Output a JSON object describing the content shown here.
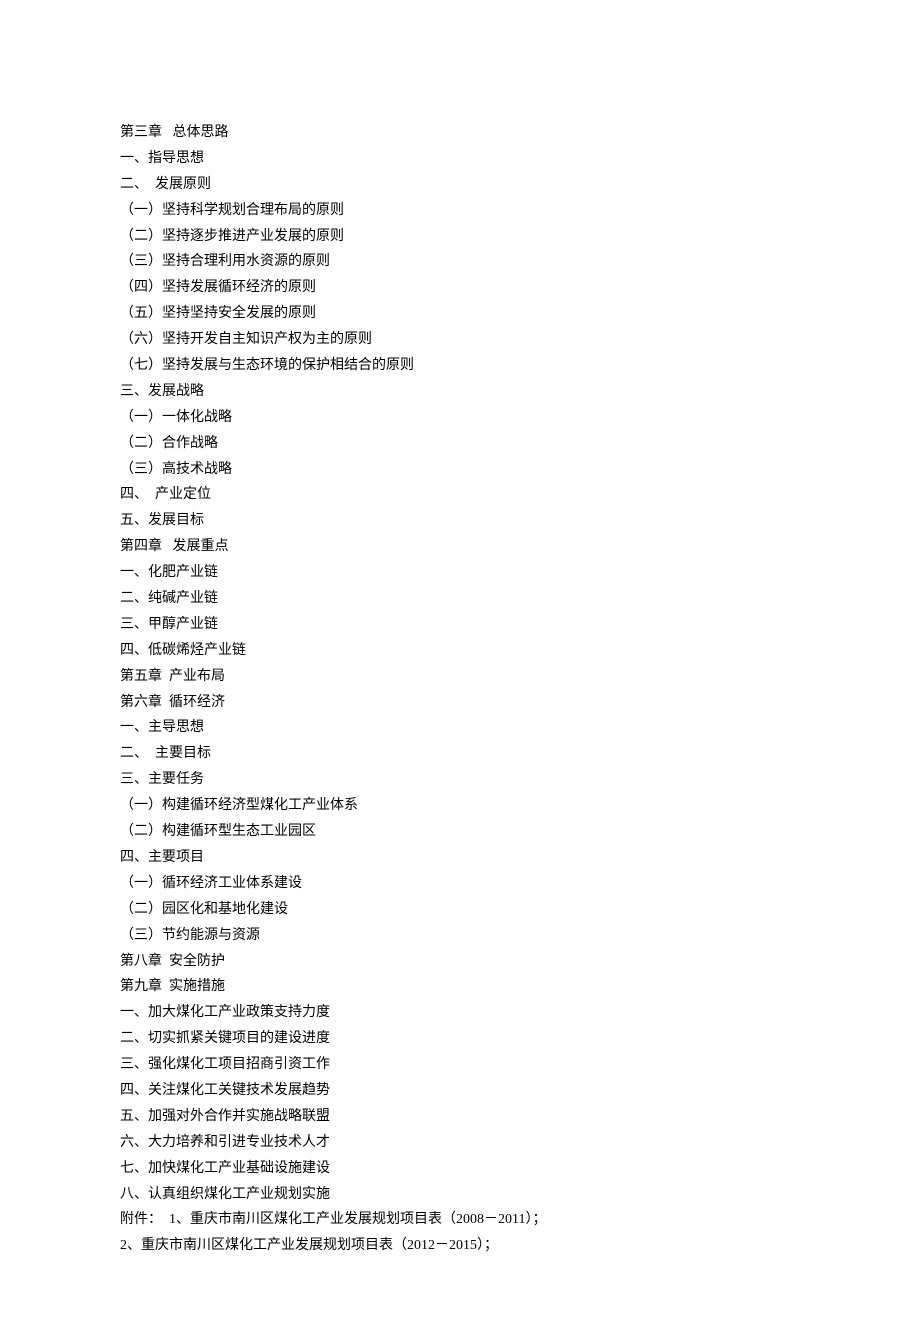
{
  "lines": [
    "第三章   总体思路",
    "一、指导思想",
    "二、  发展原则",
    "（一）坚持科学规划合理布局的原则",
    "（二）坚持逐步推进产业发展的原则",
    "（三）坚持合理利用水资源的原则",
    "（四）坚持发展循环经济的原则",
    "（五）坚持坚持安全发展的原则",
    "（六）坚持开发自主知识产权为主的原则",
    "（七）坚持发展与生态环境的保护相结合的原则",
    "三、发展战略",
    "（一）一体化战略",
    "（二）合作战略",
    "（三）高技术战略",
    "四、  产业定位",
    "五、发展目标",
    "第四章   发展重点",
    "一、化肥产业链",
    "二、纯碱产业链",
    "三、甲醇产业链",
    "四、低碳烯烃产业链",
    "第五章  产业布局",
    "第六章  循环经济",
    "一、主导思想",
    "二、  主要目标",
    "三、主要任务",
    "（一）构建循环经济型煤化工产业体系",
    "（二）构建循环型生态工业园区",
    "四、主要项目",
    "（一）循环经济工业体系建设",
    "（二）园区化和基地化建设",
    "（三）节约能源与资源",
    "第八章  安全防护",
    "第九章  实施措施",
    "一、加大煤化工产业政策支持力度",
    "二、切实抓紧关键项目的建设进度",
    "三、强化煤化工项目招商引资工作",
    "四、关注煤化工关键技术发展趋势",
    "五、加强对外合作并实施战略联盟",
    "六、大力培养和引进专业技术人才",
    "七、加快煤化工产业基础设施建设",
    "八、认真组织煤化工产业规划实施",
    "附件：  1、重庆市南川区煤化工产业发展规划项目表（2008－2011）；",
    "2、重庆市南川区煤化工产业发展规划项目表（2012－2015）；"
  ]
}
